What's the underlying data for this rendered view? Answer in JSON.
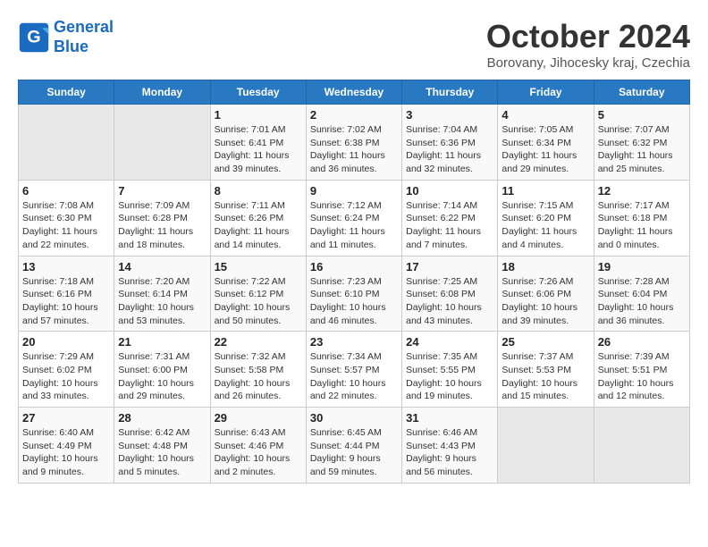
{
  "header": {
    "logo_line1": "General",
    "logo_line2": "Blue",
    "month": "October 2024",
    "location": "Borovany, Jihocesky kraj, Czechia"
  },
  "weekdays": [
    "Sunday",
    "Monday",
    "Tuesday",
    "Wednesday",
    "Thursday",
    "Friday",
    "Saturday"
  ],
  "weeks": [
    [
      {
        "day": "",
        "info": ""
      },
      {
        "day": "",
        "info": ""
      },
      {
        "day": "1",
        "info": "Sunrise: 7:01 AM\nSunset: 6:41 PM\nDaylight: 11 hours and 39 minutes."
      },
      {
        "day": "2",
        "info": "Sunrise: 7:02 AM\nSunset: 6:38 PM\nDaylight: 11 hours and 36 minutes."
      },
      {
        "day": "3",
        "info": "Sunrise: 7:04 AM\nSunset: 6:36 PM\nDaylight: 11 hours and 32 minutes."
      },
      {
        "day": "4",
        "info": "Sunrise: 7:05 AM\nSunset: 6:34 PM\nDaylight: 11 hours and 29 minutes."
      },
      {
        "day": "5",
        "info": "Sunrise: 7:07 AM\nSunset: 6:32 PM\nDaylight: 11 hours and 25 minutes."
      }
    ],
    [
      {
        "day": "6",
        "info": "Sunrise: 7:08 AM\nSunset: 6:30 PM\nDaylight: 11 hours and 22 minutes."
      },
      {
        "day": "7",
        "info": "Sunrise: 7:09 AM\nSunset: 6:28 PM\nDaylight: 11 hours and 18 minutes."
      },
      {
        "day": "8",
        "info": "Sunrise: 7:11 AM\nSunset: 6:26 PM\nDaylight: 11 hours and 14 minutes."
      },
      {
        "day": "9",
        "info": "Sunrise: 7:12 AM\nSunset: 6:24 PM\nDaylight: 11 hours and 11 minutes."
      },
      {
        "day": "10",
        "info": "Sunrise: 7:14 AM\nSunset: 6:22 PM\nDaylight: 11 hours and 7 minutes."
      },
      {
        "day": "11",
        "info": "Sunrise: 7:15 AM\nSunset: 6:20 PM\nDaylight: 11 hours and 4 minutes."
      },
      {
        "day": "12",
        "info": "Sunrise: 7:17 AM\nSunset: 6:18 PM\nDaylight: 11 hours and 0 minutes."
      }
    ],
    [
      {
        "day": "13",
        "info": "Sunrise: 7:18 AM\nSunset: 6:16 PM\nDaylight: 10 hours and 57 minutes."
      },
      {
        "day": "14",
        "info": "Sunrise: 7:20 AM\nSunset: 6:14 PM\nDaylight: 10 hours and 53 minutes."
      },
      {
        "day": "15",
        "info": "Sunrise: 7:22 AM\nSunset: 6:12 PM\nDaylight: 10 hours and 50 minutes."
      },
      {
        "day": "16",
        "info": "Sunrise: 7:23 AM\nSunset: 6:10 PM\nDaylight: 10 hours and 46 minutes."
      },
      {
        "day": "17",
        "info": "Sunrise: 7:25 AM\nSunset: 6:08 PM\nDaylight: 10 hours and 43 minutes."
      },
      {
        "day": "18",
        "info": "Sunrise: 7:26 AM\nSunset: 6:06 PM\nDaylight: 10 hours and 39 minutes."
      },
      {
        "day": "19",
        "info": "Sunrise: 7:28 AM\nSunset: 6:04 PM\nDaylight: 10 hours and 36 minutes."
      }
    ],
    [
      {
        "day": "20",
        "info": "Sunrise: 7:29 AM\nSunset: 6:02 PM\nDaylight: 10 hours and 33 minutes."
      },
      {
        "day": "21",
        "info": "Sunrise: 7:31 AM\nSunset: 6:00 PM\nDaylight: 10 hours and 29 minutes."
      },
      {
        "day": "22",
        "info": "Sunrise: 7:32 AM\nSunset: 5:58 PM\nDaylight: 10 hours and 26 minutes."
      },
      {
        "day": "23",
        "info": "Sunrise: 7:34 AM\nSunset: 5:57 PM\nDaylight: 10 hours and 22 minutes."
      },
      {
        "day": "24",
        "info": "Sunrise: 7:35 AM\nSunset: 5:55 PM\nDaylight: 10 hours and 19 minutes."
      },
      {
        "day": "25",
        "info": "Sunrise: 7:37 AM\nSunset: 5:53 PM\nDaylight: 10 hours and 15 minutes."
      },
      {
        "day": "26",
        "info": "Sunrise: 7:39 AM\nSunset: 5:51 PM\nDaylight: 10 hours and 12 minutes."
      }
    ],
    [
      {
        "day": "27",
        "info": "Sunrise: 6:40 AM\nSunset: 4:49 PM\nDaylight: 10 hours and 9 minutes."
      },
      {
        "day": "28",
        "info": "Sunrise: 6:42 AM\nSunset: 4:48 PM\nDaylight: 10 hours and 5 minutes."
      },
      {
        "day": "29",
        "info": "Sunrise: 6:43 AM\nSunset: 4:46 PM\nDaylight: 10 hours and 2 minutes."
      },
      {
        "day": "30",
        "info": "Sunrise: 6:45 AM\nSunset: 4:44 PM\nDaylight: 9 hours and 59 minutes."
      },
      {
        "day": "31",
        "info": "Sunrise: 6:46 AM\nSunset: 4:43 PM\nDaylight: 9 hours and 56 minutes."
      },
      {
        "day": "",
        "info": ""
      },
      {
        "day": "",
        "info": ""
      }
    ]
  ]
}
